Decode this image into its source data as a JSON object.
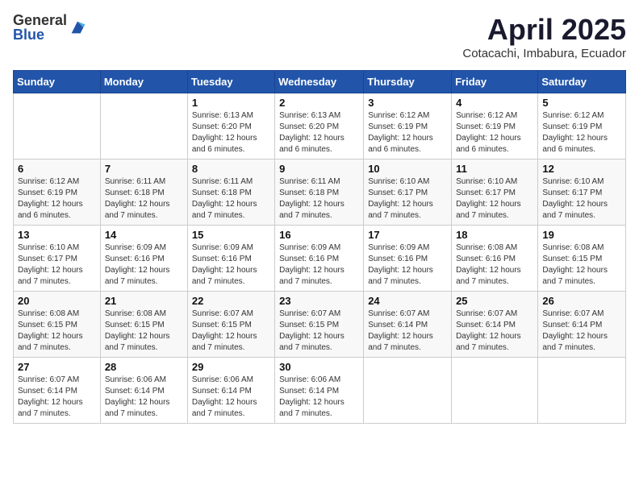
{
  "logo": {
    "general": "General",
    "blue": "Blue"
  },
  "title": "April 2025",
  "subtitle": "Cotacachi, Imbabura, Ecuador",
  "headers": [
    "Sunday",
    "Monday",
    "Tuesday",
    "Wednesday",
    "Thursday",
    "Friday",
    "Saturday"
  ],
  "weeks": [
    [
      {
        "day": "",
        "detail": ""
      },
      {
        "day": "",
        "detail": ""
      },
      {
        "day": "1",
        "detail": "Sunrise: 6:13 AM\nSunset: 6:20 PM\nDaylight: 12 hours and 6 minutes."
      },
      {
        "day": "2",
        "detail": "Sunrise: 6:13 AM\nSunset: 6:20 PM\nDaylight: 12 hours and 6 minutes."
      },
      {
        "day": "3",
        "detail": "Sunrise: 6:12 AM\nSunset: 6:19 PM\nDaylight: 12 hours and 6 minutes."
      },
      {
        "day": "4",
        "detail": "Sunrise: 6:12 AM\nSunset: 6:19 PM\nDaylight: 12 hours and 6 minutes."
      },
      {
        "day": "5",
        "detail": "Sunrise: 6:12 AM\nSunset: 6:19 PM\nDaylight: 12 hours and 6 minutes."
      }
    ],
    [
      {
        "day": "6",
        "detail": "Sunrise: 6:12 AM\nSunset: 6:19 PM\nDaylight: 12 hours and 6 minutes."
      },
      {
        "day": "7",
        "detail": "Sunrise: 6:11 AM\nSunset: 6:18 PM\nDaylight: 12 hours and 7 minutes."
      },
      {
        "day": "8",
        "detail": "Sunrise: 6:11 AM\nSunset: 6:18 PM\nDaylight: 12 hours and 7 minutes."
      },
      {
        "day": "9",
        "detail": "Sunrise: 6:11 AM\nSunset: 6:18 PM\nDaylight: 12 hours and 7 minutes."
      },
      {
        "day": "10",
        "detail": "Sunrise: 6:10 AM\nSunset: 6:17 PM\nDaylight: 12 hours and 7 minutes."
      },
      {
        "day": "11",
        "detail": "Sunrise: 6:10 AM\nSunset: 6:17 PM\nDaylight: 12 hours and 7 minutes."
      },
      {
        "day": "12",
        "detail": "Sunrise: 6:10 AM\nSunset: 6:17 PM\nDaylight: 12 hours and 7 minutes."
      }
    ],
    [
      {
        "day": "13",
        "detail": "Sunrise: 6:10 AM\nSunset: 6:17 PM\nDaylight: 12 hours and 7 minutes."
      },
      {
        "day": "14",
        "detail": "Sunrise: 6:09 AM\nSunset: 6:16 PM\nDaylight: 12 hours and 7 minutes."
      },
      {
        "day": "15",
        "detail": "Sunrise: 6:09 AM\nSunset: 6:16 PM\nDaylight: 12 hours and 7 minutes."
      },
      {
        "day": "16",
        "detail": "Sunrise: 6:09 AM\nSunset: 6:16 PM\nDaylight: 12 hours and 7 minutes."
      },
      {
        "day": "17",
        "detail": "Sunrise: 6:09 AM\nSunset: 6:16 PM\nDaylight: 12 hours and 7 minutes."
      },
      {
        "day": "18",
        "detail": "Sunrise: 6:08 AM\nSunset: 6:16 PM\nDaylight: 12 hours and 7 minutes."
      },
      {
        "day": "19",
        "detail": "Sunrise: 6:08 AM\nSunset: 6:15 PM\nDaylight: 12 hours and 7 minutes."
      }
    ],
    [
      {
        "day": "20",
        "detail": "Sunrise: 6:08 AM\nSunset: 6:15 PM\nDaylight: 12 hours and 7 minutes."
      },
      {
        "day": "21",
        "detail": "Sunrise: 6:08 AM\nSunset: 6:15 PM\nDaylight: 12 hours and 7 minutes."
      },
      {
        "day": "22",
        "detail": "Sunrise: 6:07 AM\nSunset: 6:15 PM\nDaylight: 12 hours and 7 minutes."
      },
      {
        "day": "23",
        "detail": "Sunrise: 6:07 AM\nSunset: 6:15 PM\nDaylight: 12 hours and 7 minutes."
      },
      {
        "day": "24",
        "detail": "Sunrise: 6:07 AM\nSunset: 6:14 PM\nDaylight: 12 hours and 7 minutes."
      },
      {
        "day": "25",
        "detail": "Sunrise: 6:07 AM\nSunset: 6:14 PM\nDaylight: 12 hours and 7 minutes."
      },
      {
        "day": "26",
        "detail": "Sunrise: 6:07 AM\nSunset: 6:14 PM\nDaylight: 12 hours and 7 minutes."
      }
    ],
    [
      {
        "day": "27",
        "detail": "Sunrise: 6:07 AM\nSunset: 6:14 PM\nDaylight: 12 hours and 7 minutes."
      },
      {
        "day": "28",
        "detail": "Sunrise: 6:06 AM\nSunset: 6:14 PM\nDaylight: 12 hours and 7 minutes."
      },
      {
        "day": "29",
        "detail": "Sunrise: 6:06 AM\nSunset: 6:14 PM\nDaylight: 12 hours and 7 minutes."
      },
      {
        "day": "30",
        "detail": "Sunrise: 6:06 AM\nSunset: 6:14 PM\nDaylight: 12 hours and 7 minutes."
      },
      {
        "day": "",
        "detail": ""
      },
      {
        "day": "",
        "detail": ""
      },
      {
        "day": "",
        "detail": ""
      }
    ]
  ]
}
